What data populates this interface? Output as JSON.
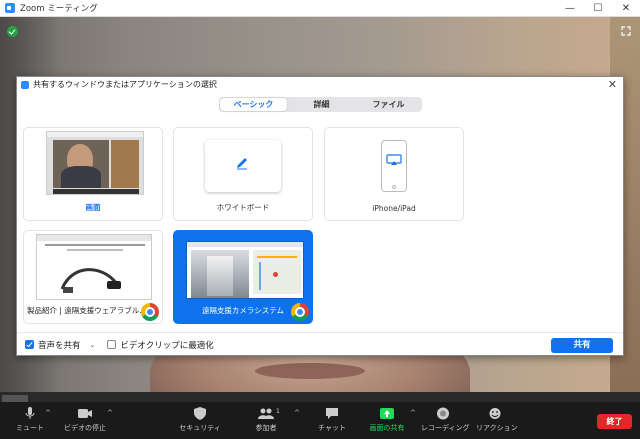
{
  "window": {
    "title": "Zoom ミーティング",
    "min": "—",
    "max": "☐",
    "close": "✕"
  },
  "video": {
    "camera_label": ""
  },
  "dialog": {
    "title": "共有するウィンドウまたはアプリケーションの選択",
    "close": "✕",
    "tabs": [
      {
        "label": "ベーシック",
        "active": true
      },
      {
        "label": "詳細",
        "active": false
      },
      {
        "label": "ファイル",
        "active": false
      }
    ],
    "sources": [
      {
        "label": "画面",
        "selected": false
      },
      {
        "label": "ホワイトボード",
        "selected": false
      },
      {
        "label": "iPhone/iPad",
        "selected": false
      },
      {
        "label": "製品紹介 | 遠隔支援ウェアラブル...",
        "selected": false
      },
      {
        "label": "遠隔支援カメラシステム",
        "selected": true
      }
    ],
    "options": {
      "share_audio": {
        "label": "音声を共有",
        "checked": true
      },
      "optimize_video": {
        "label": "ビデオクリップに最適化",
        "checked": false
      }
    },
    "share_button": "共有"
  },
  "toolbar": {
    "items": [
      {
        "label": "ミュート",
        "icon": "microphone-icon"
      },
      {
        "label": "ビデオの停止",
        "icon": "video-camera-icon"
      },
      {
        "label": "セキュリティ",
        "icon": "shield-icon"
      },
      {
        "label": "参加者",
        "icon": "participants-icon",
        "count": "1"
      },
      {
        "label": "チャット",
        "icon": "chat-icon"
      },
      {
        "label": "画面の共有",
        "icon": "share-screen-icon"
      },
      {
        "label": "レコーディング",
        "icon": "record-icon"
      },
      {
        "label": "リアクション",
        "icon": "reaction-icon"
      }
    ],
    "end_button": "終了"
  },
  "colors": {
    "accent": "#0e72ed",
    "share_green": "#23d959",
    "end_red": "#e02828"
  }
}
